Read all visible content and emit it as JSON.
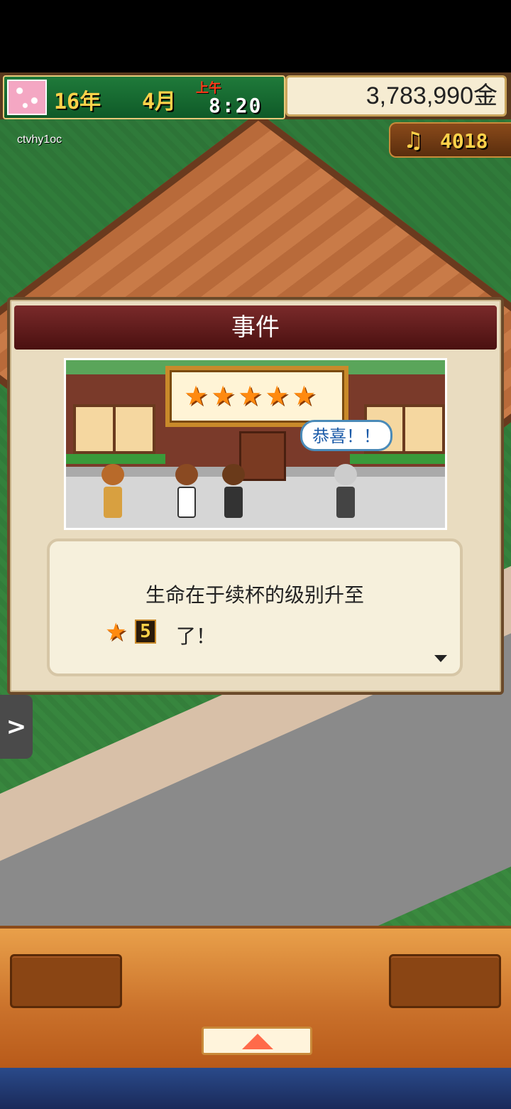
{
  "hud": {
    "year": "16年",
    "month": "4月",
    "ampm": "上午",
    "time": "8:20",
    "money": "3,783,990金",
    "points": "4018",
    "player_id": "ctvhy1oc"
  },
  "event": {
    "title": "事件",
    "speech": "恭喜！！",
    "stars": 5,
    "message_line1": "生命在于续杯的级别升至",
    "level": "5",
    "message_line2": "了！"
  },
  "side_tab": {
    "icon": "chevron-right-icon"
  },
  "colors": {
    "title_bar": "#5a1414",
    "money_bg": "#f6ecd2",
    "gold_text": "#ffd24a",
    "star": "#ff8a10"
  }
}
